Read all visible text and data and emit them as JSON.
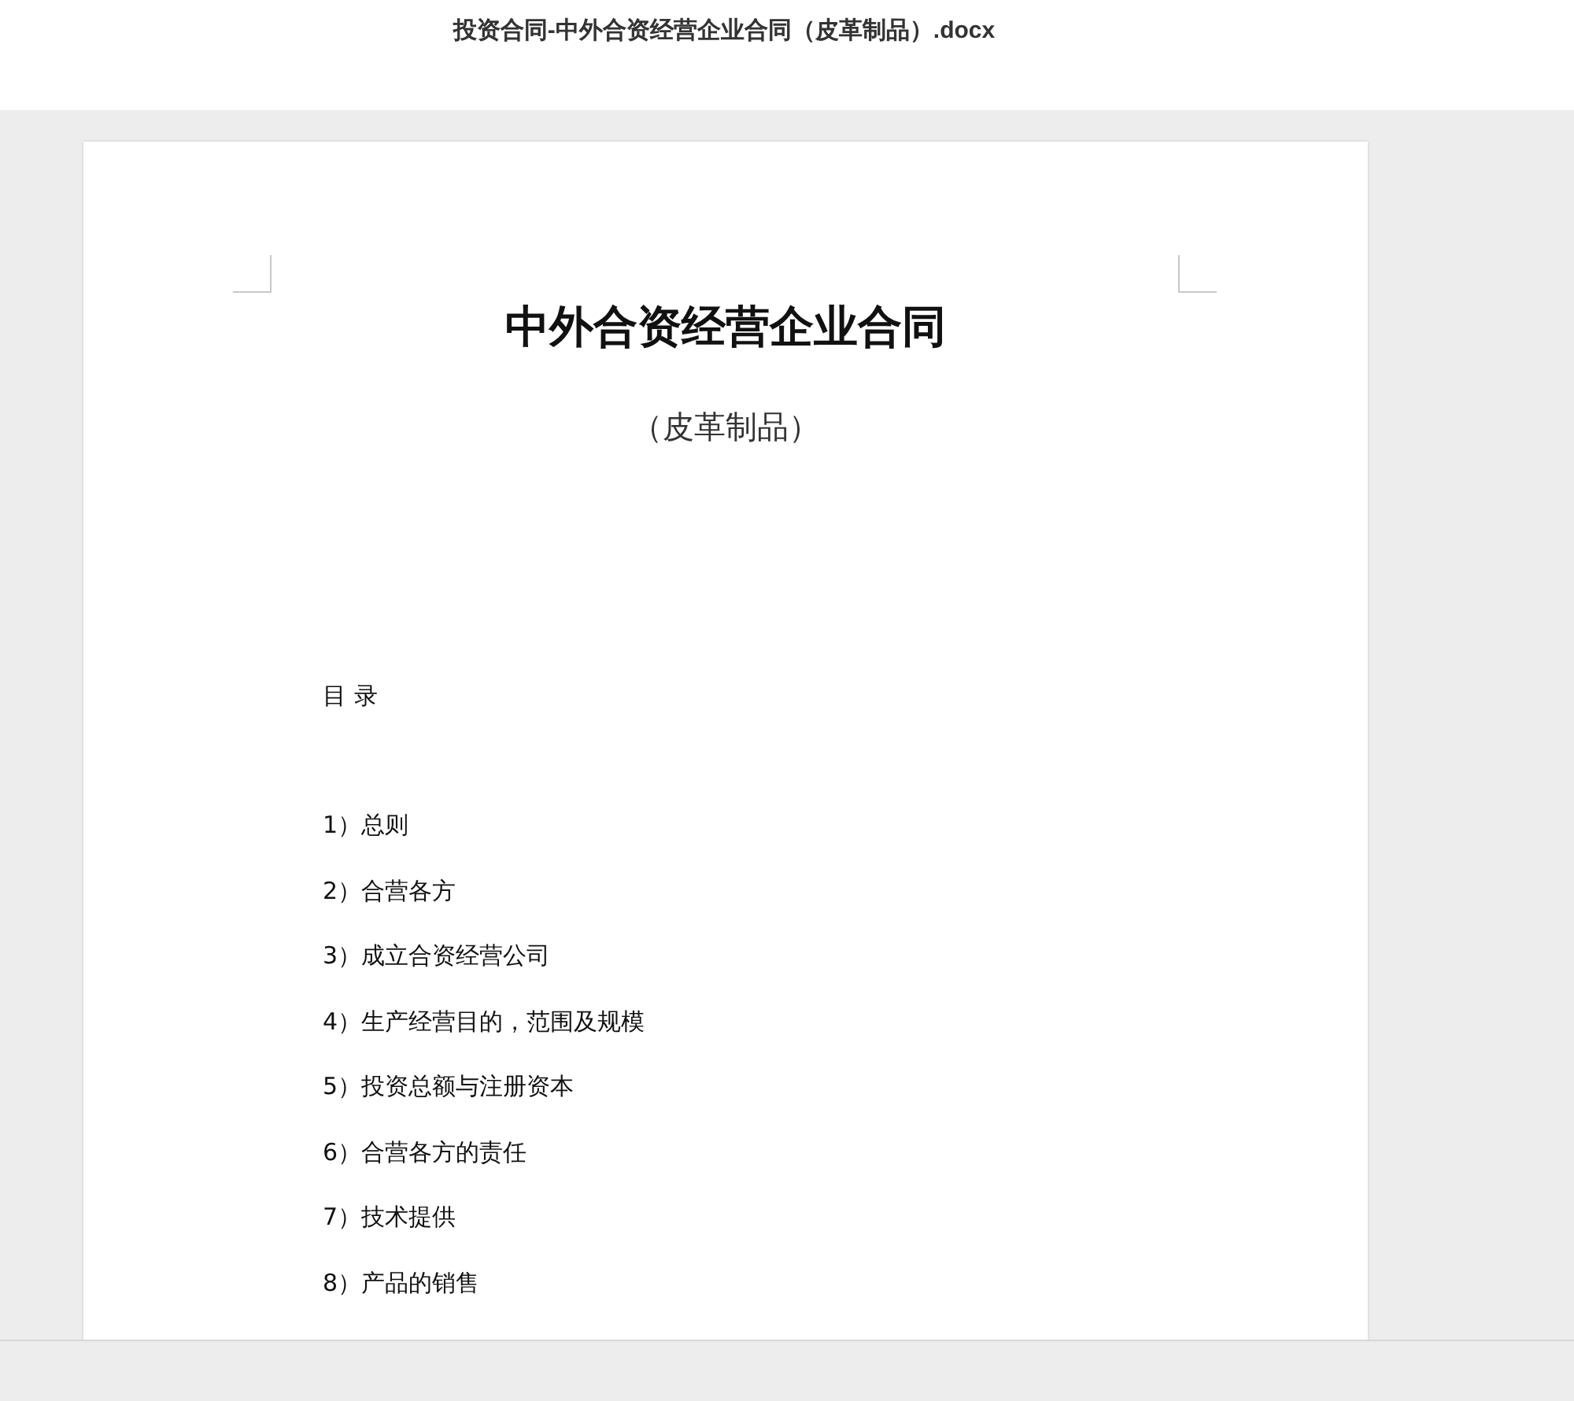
{
  "window": {
    "title": "投资合同-中外合资经营企业合同（皮革制品）.docx"
  },
  "document": {
    "title": "中外合资经营企业合同",
    "subtitle": "（皮革制品）",
    "toc_heading": "目 录",
    "toc_items": [
      "1）总则",
      "2）合营各方",
      "3）成立合资经营公司",
      "4）生产经营目的，范围及规模",
      "5）投资总额与注册资本",
      "6）合营各方的责任",
      "7）技术提供",
      "8）产品的销售"
    ]
  }
}
